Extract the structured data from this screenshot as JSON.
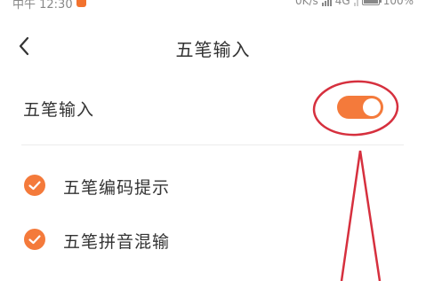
{
  "status_bar": {
    "time": "中午 12:30",
    "network_speed": "0K/s",
    "network_type": "4G",
    "battery": "100%"
  },
  "header": {
    "title": "五笔输入"
  },
  "settings": {
    "wubi_input": {
      "label": "五笔输入",
      "enabled": true
    },
    "options": [
      {
        "label": "五笔编码提示",
        "checked": true
      },
      {
        "label": "五笔拼音混输",
        "checked": true
      }
    ]
  },
  "colors": {
    "accent": "#f47a3b",
    "annotation": "#d6303e"
  },
  "icons": {
    "back": "chevron-left-icon",
    "check": "check-icon"
  }
}
